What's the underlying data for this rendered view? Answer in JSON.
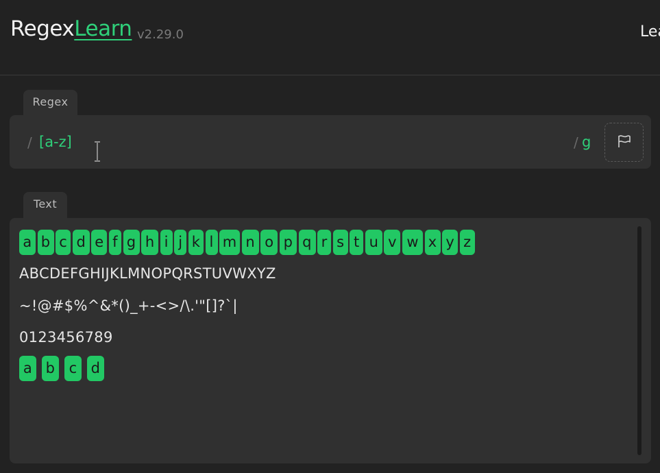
{
  "header": {
    "logo_regex": "Regex",
    "logo_learn": "Learn",
    "version": "v2.29.0",
    "nav_learn": "Lea"
  },
  "regex_panel": {
    "tab_label": "Regex",
    "slash_open": "/",
    "pattern": "[a-z]",
    "slash_close": "/",
    "flags": "g"
  },
  "text_panel": {
    "tab_label": "Text",
    "line1_matches": [
      "a",
      "b",
      "c",
      "d",
      "e",
      "f",
      "g",
      "h",
      "i",
      "j",
      "k",
      "l",
      "m",
      "n",
      "o",
      "p",
      "q",
      "r",
      "s",
      "t",
      "u",
      "v",
      "w",
      "x",
      "y",
      "z"
    ],
    "line2": "ABCDEFGHIJKLMNOPQRSTUVWXYZ",
    "line3": "~!@#$%^&*()_+-<>/\\.'\"[]?`|",
    "line4": "0123456789",
    "line5_matches": [
      "a",
      "b",
      "c",
      "d"
    ]
  },
  "colors": {
    "accent": "#2fd07a",
    "match_bg": "#22c864",
    "background": "#222222",
    "panel": "#303030"
  },
  "icons": {
    "flags_button": "flag-icon",
    "cursor": "text-cursor-icon"
  }
}
